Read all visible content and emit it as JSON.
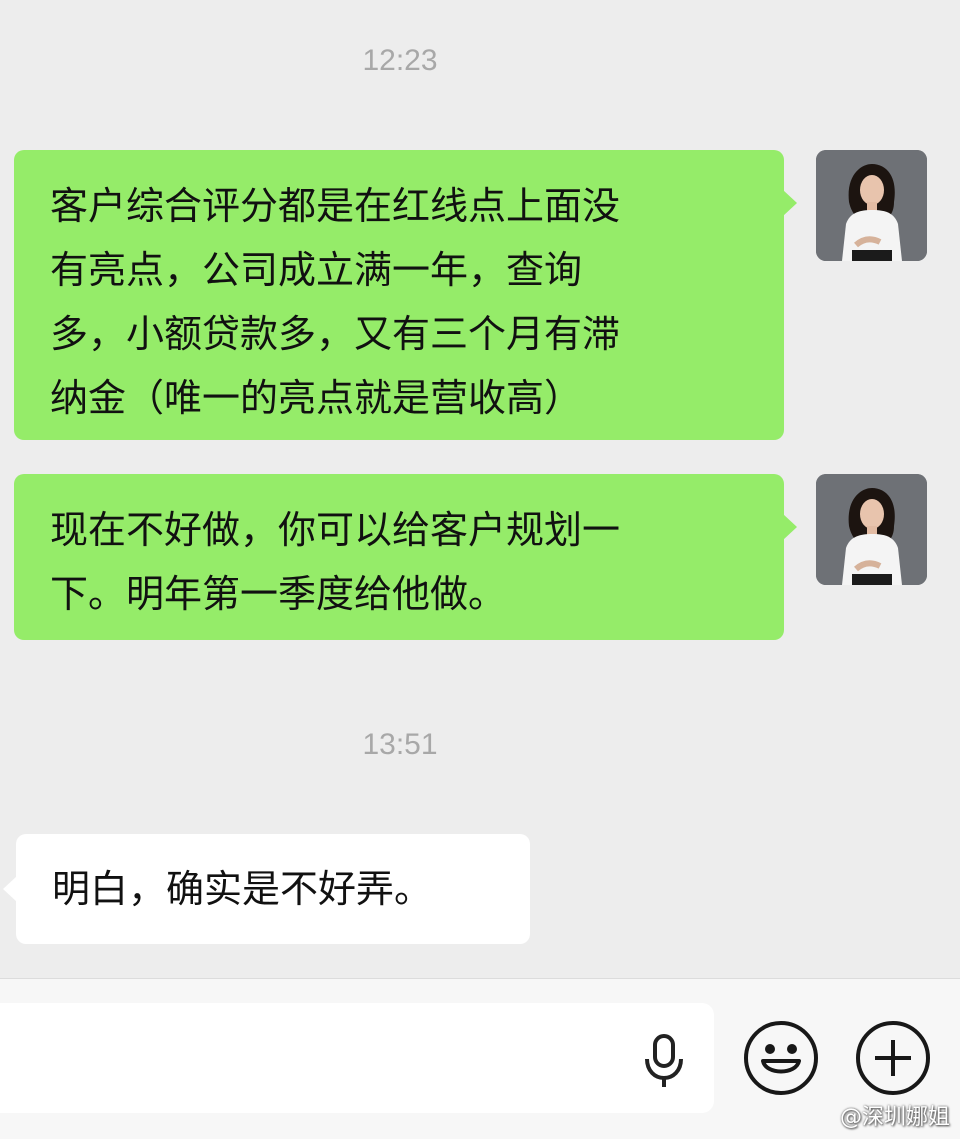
{
  "timestamps": [
    "12:23",
    "13:51"
  ],
  "messages": [
    {
      "side": "sent",
      "lines": [
        "客户综合评分都是在红线点上面没",
        "有亮点，公司成立满一年，查询",
        "多，小额贷款多，又有三个月有滞",
        "纳金（唯一的亮点就是营收高）"
      ]
    },
    {
      "side": "sent",
      "lines": [
        "现在不好做，你可以给客户规划一",
        "下。明年第一季度给他做。"
      ]
    },
    {
      "side": "received",
      "lines": [
        "明白，确实是不好弄。"
      ]
    }
  ],
  "input_bar": {
    "value": "",
    "icons": [
      "microphone-icon",
      "emoji-icon",
      "plus-icon"
    ]
  },
  "watermark": "@深圳娜姐",
  "colors": {
    "background": "#ededed",
    "sent_bubble": "#95ec69",
    "received_bubble": "#ffffff",
    "timestamp": "#a8a8a8"
  }
}
